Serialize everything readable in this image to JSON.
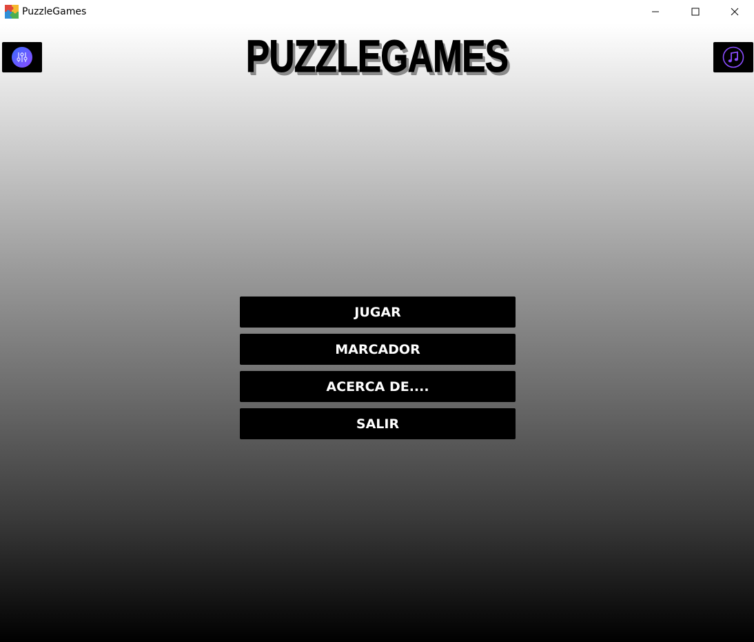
{
  "window": {
    "title": "PuzzleGames"
  },
  "header": {
    "logo_text": "PUZZLEGAMES",
    "settings_icon": "sliders-icon",
    "music_icon": "music-note-icon"
  },
  "menu": {
    "items": [
      {
        "label": "JUGAR"
      },
      {
        "label": "MARCADOR"
      },
      {
        "label": "ACERCA DE...."
      },
      {
        "label": "SALIR"
      }
    ]
  },
  "colors": {
    "button_bg": "#000000",
    "button_text": "#ffffff",
    "settings_icon_gradient": [
      "#3d6bff",
      "#8a4dff"
    ],
    "music_icon_color": "#8a4dff"
  }
}
